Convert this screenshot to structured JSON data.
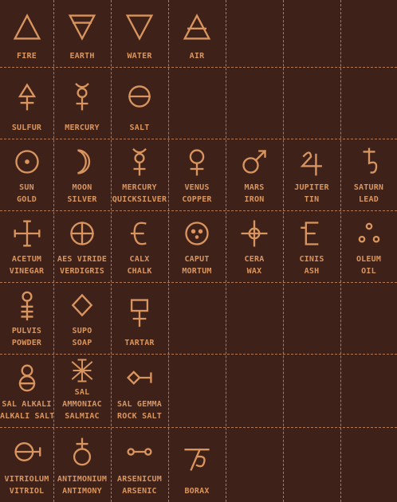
{
  "rows": [
    [
      {
        "icon": "fire-triangle-icon",
        "lines": [
          "FIRE"
        ]
      },
      {
        "icon": "earth-triangle-icon",
        "lines": [
          "EARTH"
        ]
      },
      {
        "icon": "water-triangle-icon",
        "lines": [
          "WATER"
        ]
      },
      {
        "icon": "air-triangle-icon",
        "lines": [
          "AIR"
        ]
      }
    ],
    [
      {
        "icon": "sulfur-icon",
        "lines": [
          "SULFUR"
        ]
      },
      {
        "icon": "mercury-icon",
        "lines": [
          "MERCURY"
        ]
      },
      {
        "icon": "salt-icon",
        "lines": [
          "SALT"
        ]
      }
    ],
    [
      {
        "icon": "sun-gold-icon",
        "lines": [
          "SUN",
          "GOLD"
        ]
      },
      {
        "icon": "moon-silver-icon",
        "lines": [
          "MOON",
          "SILVER"
        ]
      },
      {
        "icon": "mercury-quicksilver-icon",
        "lines": [
          "MERCURY",
          "QUICKSILVER"
        ]
      },
      {
        "icon": "venus-copper-icon",
        "lines": [
          "VENUS",
          "COPPER"
        ]
      },
      {
        "icon": "mars-iron-icon",
        "lines": [
          "MARS",
          "IRON"
        ]
      },
      {
        "icon": "jupiter-tin-icon",
        "lines": [
          "JUPITER",
          "TIN"
        ]
      },
      {
        "icon": "saturn-lead-icon",
        "lines": [
          "SATURN",
          "LEAD"
        ]
      }
    ],
    [
      {
        "icon": "acetum-vinegar-icon",
        "lines": [
          "ACETUM",
          "VINEGAR"
        ]
      },
      {
        "icon": "aes-viride-verdigris-icon",
        "lines": [
          "AES VIRIDE",
          "VERDIGRIS"
        ]
      },
      {
        "icon": "calx-chalk-icon",
        "lines": [
          "CALX",
          "CHALK"
        ]
      },
      {
        "icon": "caput-mortum-icon",
        "lines": [
          "CAPUT",
          "MORTUM"
        ]
      },
      {
        "icon": "cera-wax-icon",
        "lines": [
          "CERA",
          "WAX"
        ]
      },
      {
        "icon": "cinis-ash-icon",
        "lines": [
          "CINIS",
          "ASH"
        ]
      },
      {
        "icon": "oleum-oil-icon",
        "lines": [
          "OLEUM",
          "OIL"
        ]
      }
    ],
    [
      {
        "icon": "pulvis-powder-icon",
        "lines": [
          "PULVIS",
          "POWDER"
        ]
      },
      {
        "icon": "sapo-soap-icon",
        "lines": [
          "SUPO",
          "SOAP"
        ]
      },
      {
        "icon": "tartar-icon",
        "lines": [
          "TARTAR"
        ]
      }
    ],
    [
      {
        "icon": "sal-alkali-icon",
        "lines": [
          "SAL ALKALI",
          "ALKALI SALT"
        ]
      },
      {
        "icon": "sal-ammoniac-icon",
        "lines": [
          "SAL",
          "AMMONIAC",
          "SALMIAC"
        ]
      },
      {
        "icon": "sal-gemma-icon",
        "lines": [
          "SAL GEMMA",
          "ROCK SALT"
        ]
      }
    ],
    [
      {
        "icon": "vitriolum-icon",
        "lines": [
          "VITRIOLUM",
          "VITRIOL"
        ]
      },
      {
        "icon": "antimonium-icon",
        "lines": [
          "ANTIMONIUM",
          "ANTIMONY"
        ]
      },
      {
        "icon": "arsenicum-icon",
        "lines": [
          "ARSENICUM",
          "ARSENIC"
        ]
      },
      {
        "icon": "borax-icon",
        "lines": [
          "BORAX"
        ]
      }
    ]
  ],
  "colors": {
    "background": "#3e2119",
    "symbol": "#d9955f",
    "grid": "#c98760"
  }
}
